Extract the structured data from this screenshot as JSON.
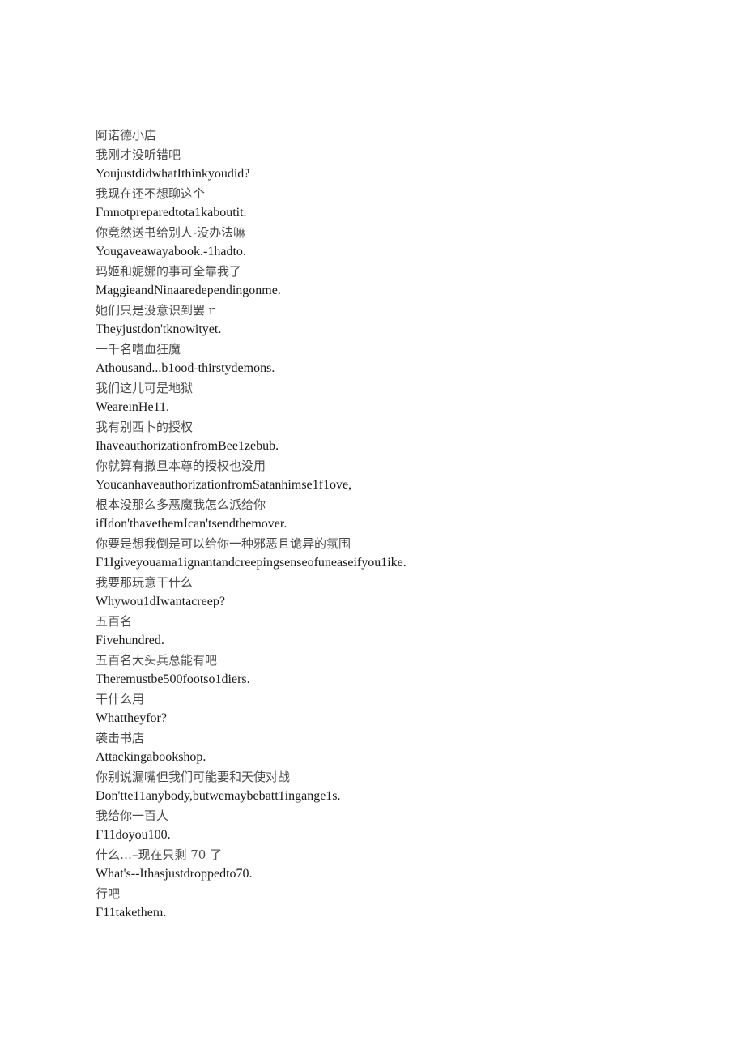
{
  "document": {
    "type": "bilingual-subtitle-transcript",
    "background_color": "#ffffff",
    "zh_text_color": "#4a4a4a",
    "en_text_color": "#1a1a1a",
    "lines": [
      {
        "lang": "zh",
        "text": "阿诺德小店"
      },
      {
        "lang": "zh",
        "text": "我刚才没听错吧"
      },
      {
        "lang": "en",
        "text": "YoujustdidwhatIthinkyoudid?"
      },
      {
        "lang": "zh",
        "text": "我现在还不想聊这个"
      },
      {
        "lang": "en",
        "text": "Γmnotpreparedtota1kaboutit."
      },
      {
        "lang": "zh",
        "text": "你竟然送书给别人-没办法嘛"
      },
      {
        "lang": "en",
        "text": "Yougaveawayabook.-1hadto."
      },
      {
        "lang": "zh",
        "text": "玛姬和妮娜的事可全靠我了"
      },
      {
        "lang": "en",
        "text": "MaggieandNinaaredependingonme."
      },
      {
        "lang": "zh",
        "text": "她们只是没意识到罢 r"
      },
      {
        "lang": "en",
        "text": "Theyjustdon'tknowityet."
      },
      {
        "lang": "zh",
        "text": "一千名嗜血狂魔"
      },
      {
        "lang": "en",
        "text": "Athousand...b1ood-thirstydemons."
      },
      {
        "lang": "zh",
        "text": "我们这儿可是地狱"
      },
      {
        "lang": "en",
        "text": "WeareinHe11."
      },
      {
        "lang": "zh",
        "text": "我有别西卜的授权"
      },
      {
        "lang": "en",
        "text": "IhaveauthorizationfromBee1zebub."
      },
      {
        "lang": "zh",
        "text": "你就算有撒旦本尊的授权也没用"
      },
      {
        "lang": "en",
        "text": "YoucanhaveauthorizationfromSatanhimse1f1ove,"
      },
      {
        "lang": "zh",
        "text": "根本没那么多恶魔我怎么派给你"
      },
      {
        "lang": "en",
        "text": "ifIdon'thavethemIcan'tsendthemover."
      },
      {
        "lang": "zh",
        "text": "你要是想我倒是可以给你一种邪恶且诡异的氛围"
      },
      {
        "lang": "en",
        "text": "Γ1Igiveyouama1ignantandcreepingsenseofuneaseifyou1ike."
      },
      {
        "lang": "zh",
        "text": "我要那玩意干什么"
      },
      {
        "lang": "en",
        "text": "Whywou1dIwantacreep?"
      },
      {
        "lang": "zh",
        "text": "五百名"
      },
      {
        "lang": "en",
        "text": "Fivehundred."
      },
      {
        "lang": "zh",
        "text": "五百名大头兵总能有吧"
      },
      {
        "lang": "en",
        "text": "Theremustbe500footso1diers."
      },
      {
        "lang": "zh",
        "text": "干什么用"
      },
      {
        "lang": "en",
        "text": "Whattheyfor?"
      },
      {
        "lang": "zh",
        "text": "袭击书店"
      },
      {
        "lang": "en",
        "text": "Attackingabookshop."
      },
      {
        "lang": "zh",
        "text": "你别说漏嘴但我们可能要和天使对战"
      },
      {
        "lang": "en",
        "text": "Don'tte11anybody,butwemaybebatt1ingange1s."
      },
      {
        "lang": "zh",
        "text": "我给你一百人"
      },
      {
        "lang": "en",
        "text": "Γ11doyou100."
      },
      {
        "lang": "zh",
        "text": "什么…–现在只剩 70 了"
      },
      {
        "lang": "en",
        "text": "What's--Ithasjustdroppedto70."
      },
      {
        "lang": "zh",
        "text": "行吧"
      },
      {
        "lang": "en",
        "text": "Γ11takethem."
      }
    ]
  }
}
